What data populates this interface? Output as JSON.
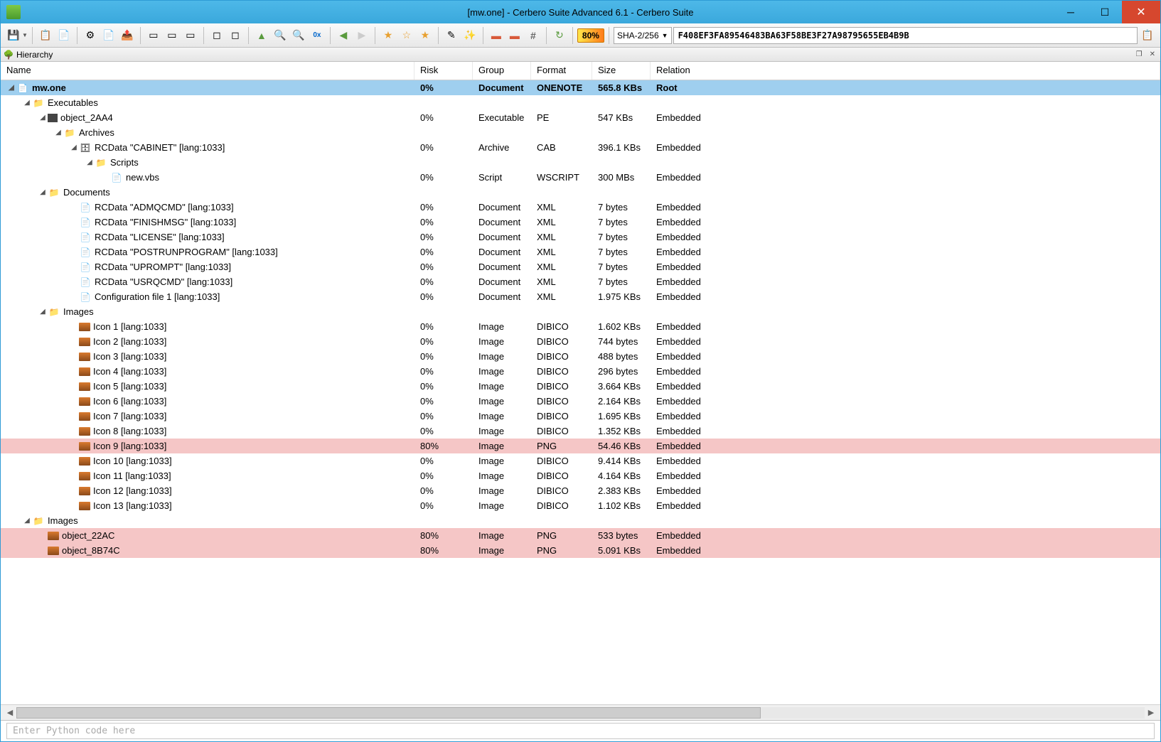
{
  "window": {
    "title": "[mw.one] - Cerbero Suite Advanced 6.1 - Cerbero Suite"
  },
  "toolbar": {
    "risk_badge": "80%",
    "hash_algo": "SHA-2/256",
    "hash_value": "F408EF3FA89546483BA63F58BE3F27A98795655EB4B9B"
  },
  "panel": {
    "title": "Hierarchy"
  },
  "columns": {
    "name": "Name",
    "risk": "Risk",
    "group": "Group",
    "format": "Format",
    "size": "Size",
    "relation": "Relation"
  },
  "rows": [
    {
      "indent": 0,
      "exp": "▲",
      "icon": "file",
      "name": "mw.one",
      "risk": "0%",
      "group": "Document",
      "format": "ONENOTE",
      "size": "565.8 KBs",
      "relation": "Root",
      "sel": true
    },
    {
      "indent": 1,
      "exp": "▲",
      "icon": "folder",
      "name": "Executables",
      "risk": "",
      "group": "",
      "format": "",
      "size": "",
      "relation": ""
    },
    {
      "indent": 2,
      "exp": "▲",
      "icon": "exe",
      "name": "object_2AA4",
      "risk": "0%",
      "group": "Executable",
      "format": "PE",
      "size": "547 KBs",
      "relation": "Embedded"
    },
    {
      "indent": 3,
      "exp": "▲",
      "icon": "folder",
      "name": "Archives",
      "risk": "",
      "group": "",
      "format": "",
      "size": "",
      "relation": ""
    },
    {
      "indent": 4,
      "exp": "▲",
      "icon": "arc",
      "name": "RCData \"CABINET\" [lang:1033]",
      "risk": "0%",
      "group": "Archive",
      "format": "CAB",
      "size": "396.1 KBs",
      "relation": "Embedded"
    },
    {
      "indent": 5,
      "exp": "▲",
      "icon": "folder",
      "name": "Scripts",
      "risk": "",
      "group": "",
      "format": "",
      "size": "",
      "relation": ""
    },
    {
      "indent": 6,
      "exp": "",
      "icon": "doc",
      "name": "new.vbs",
      "risk": "0%",
      "group": "Script",
      "format": "WSCRIPT",
      "size": "300 MBs",
      "relation": "Embedded"
    },
    {
      "indent": 2,
      "exp": "▲",
      "icon": "folder",
      "name": "Documents",
      "risk": "",
      "group": "",
      "format": "",
      "size": "",
      "relation": ""
    },
    {
      "indent": 4,
      "exp": "",
      "icon": "doc",
      "name": "RCData \"ADMQCMD\" [lang:1033]",
      "risk": "0%",
      "group": "Document",
      "format": "XML",
      "size": "7 bytes",
      "relation": "Embedded"
    },
    {
      "indent": 4,
      "exp": "",
      "icon": "doc",
      "name": "RCData \"FINISHMSG\" [lang:1033]",
      "risk": "0%",
      "group": "Document",
      "format": "XML",
      "size": "7 bytes",
      "relation": "Embedded"
    },
    {
      "indent": 4,
      "exp": "",
      "icon": "doc",
      "name": "RCData \"LICENSE\" [lang:1033]",
      "risk": "0%",
      "group": "Document",
      "format": "XML",
      "size": "7 bytes",
      "relation": "Embedded"
    },
    {
      "indent": 4,
      "exp": "",
      "icon": "doc",
      "name": "RCData \"POSTRUNPROGRAM\" [lang:1033]",
      "risk": "0%",
      "group": "Document",
      "format": "XML",
      "size": "7 bytes",
      "relation": "Embedded"
    },
    {
      "indent": 4,
      "exp": "",
      "icon": "doc",
      "name": "RCData \"UPROMPT\" [lang:1033]",
      "risk": "0%",
      "group": "Document",
      "format": "XML",
      "size": "7 bytes",
      "relation": "Embedded"
    },
    {
      "indent": 4,
      "exp": "",
      "icon": "doc",
      "name": "RCData \"USRQCMD\" [lang:1033]",
      "risk": "0%",
      "group": "Document",
      "format": "XML",
      "size": "7 bytes",
      "relation": "Embedded"
    },
    {
      "indent": 4,
      "exp": "",
      "icon": "doc",
      "name": "Configuration file 1 [lang:1033]",
      "risk": "0%",
      "group": "Document",
      "format": "XML",
      "size": "1.975 KBs",
      "relation": "Embedded"
    },
    {
      "indent": 2,
      "exp": "▲",
      "icon": "folder",
      "name": "Images",
      "risk": "",
      "group": "",
      "format": "",
      "size": "",
      "relation": ""
    },
    {
      "indent": 4,
      "exp": "",
      "icon": "img",
      "name": "Icon 1 [lang:1033]",
      "risk": "0%",
      "group": "Image",
      "format": "DIBICO",
      "size": "1.602 KBs",
      "relation": "Embedded"
    },
    {
      "indent": 4,
      "exp": "",
      "icon": "img",
      "name": "Icon 2 [lang:1033]",
      "risk": "0%",
      "group": "Image",
      "format": "DIBICO",
      "size": "744 bytes",
      "relation": "Embedded"
    },
    {
      "indent": 4,
      "exp": "",
      "icon": "img",
      "name": "Icon 3 [lang:1033]",
      "risk": "0%",
      "group": "Image",
      "format": "DIBICO",
      "size": "488 bytes",
      "relation": "Embedded"
    },
    {
      "indent": 4,
      "exp": "",
      "icon": "img",
      "name": "Icon 4 [lang:1033]",
      "risk": "0%",
      "group": "Image",
      "format": "DIBICO",
      "size": "296 bytes",
      "relation": "Embedded"
    },
    {
      "indent": 4,
      "exp": "",
      "icon": "img",
      "name": "Icon 5 [lang:1033]",
      "risk": "0%",
      "group": "Image",
      "format": "DIBICO",
      "size": "3.664 KBs",
      "relation": "Embedded"
    },
    {
      "indent": 4,
      "exp": "",
      "icon": "img",
      "name": "Icon 6 [lang:1033]",
      "risk": "0%",
      "group": "Image",
      "format": "DIBICO",
      "size": "2.164 KBs",
      "relation": "Embedded"
    },
    {
      "indent": 4,
      "exp": "",
      "icon": "img",
      "name": "Icon 7 [lang:1033]",
      "risk": "0%",
      "group": "Image",
      "format": "DIBICO",
      "size": "1.695 KBs",
      "relation": "Embedded"
    },
    {
      "indent": 4,
      "exp": "",
      "icon": "img",
      "name": "Icon 8 [lang:1033]",
      "risk": "0%",
      "group": "Image",
      "format": "DIBICO",
      "size": "1.352 KBs",
      "relation": "Embedded"
    },
    {
      "indent": 4,
      "exp": "",
      "icon": "img",
      "name": "Icon 9 [lang:1033]",
      "risk": "80%",
      "group": "Image",
      "format": "PNG",
      "size": "54.46 KBs",
      "relation": "Embedded",
      "high": true
    },
    {
      "indent": 4,
      "exp": "",
      "icon": "img",
      "name": "Icon 10 [lang:1033]",
      "risk": "0%",
      "group": "Image",
      "format": "DIBICO",
      "size": "9.414 KBs",
      "relation": "Embedded"
    },
    {
      "indent": 4,
      "exp": "",
      "icon": "img",
      "name": "Icon 11 [lang:1033]",
      "risk": "0%",
      "group": "Image",
      "format": "DIBICO",
      "size": "4.164 KBs",
      "relation": "Embedded"
    },
    {
      "indent": 4,
      "exp": "",
      "icon": "img",
      "name": "Icon 12 [lang:1033]",
      "risk": "0%",
      "group": "Image",
      "format": "DIBICO",
      "size": "2.383 KBs",
      "relation": "Embedded"
    },
    {
      "indent": 4,
      "exp": "",
      "icon": "img",
      "name": "Icon 13 [lang:1033]",
      "risk": "0%",
      "group": "Image",
      "format": "DIBICO",
      "size": "1.102 KBs",
      "relation": "Embedded"
    },
    {
      "indent": 1,
      "exp": "▲",
      "icon": "folder",
      "name": "Images",
      "risk": "",
      "group": "",
      "format": "",
      "size": "",
      "relation": ""
    },
    {
      "indent": 2,
      "exp": "",
      "icon": "img",
      "name": "object_22AC",
      "risk": "80%",
      "group": "Image",
      "format": "PNG",
      "size": "533 bytes",
      "relation": "Embedded",
      "high": true
    },
    {
      "indent": 2,
      "exp": "",
      "icon": "img",
      "name": "object_8B74C",
      "risk": "80%",
      "group": "Image",
      "format": "PNG",
      "size": "5.091 KBs",
      "relation": "Embedded",
      "high": true
    }
  ],
  "python": {
    "placeholder": "Enter Python code here"
  }
}
